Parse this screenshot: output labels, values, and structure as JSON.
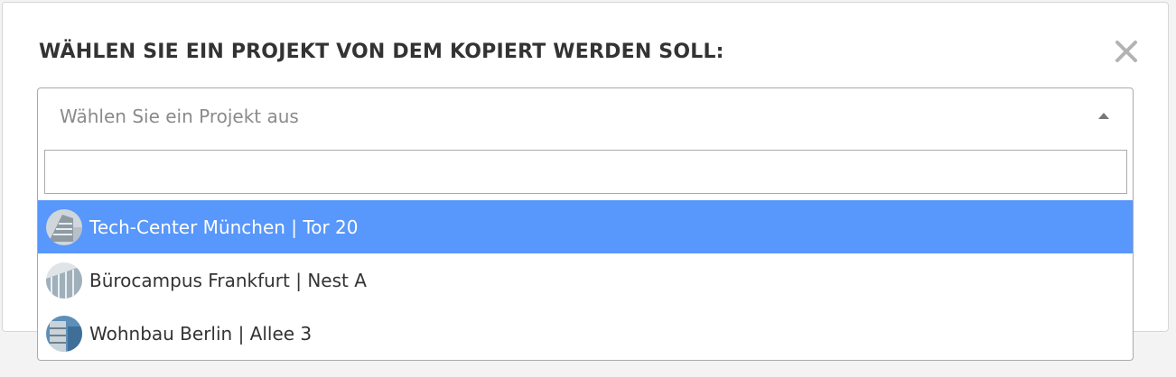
{
  "dialog": {
    "title": "WÄHLEN SIE EIN PROJEKT VON DEM KOPIERT WERDEN SOLL:",
    "close_icon": "close-icon"
  },
  "select": {
    "placeholder": "Wählen Sie ein Projekt aus",
    "arrow_icon": "caret-up-icon",
    "search_value": ""
  },
  "options": [
    {
      "label": "Tech-Center München | Tor 20",
      "highlighted": true,
      "thumb_icon": "building-thumbnail"
    },
    {
      "label": "Bürocampus Frankfurt | Nest A",
      "highlighted": false,
      "thumb_icon": "building-thumbnail"
    },
    {
      "label": "Wohnbau Berlin | Allee 3",
      "highlighted": false,
      "thumb_icon": "building-thumbnail"
    }
  ],
  "colors": {
    "highlight": "#5897fb",
    "title_text": "#333333",
    "placeholder_text": "#8a8a8a",
    "border": "#aaaaaa"
  }
}
